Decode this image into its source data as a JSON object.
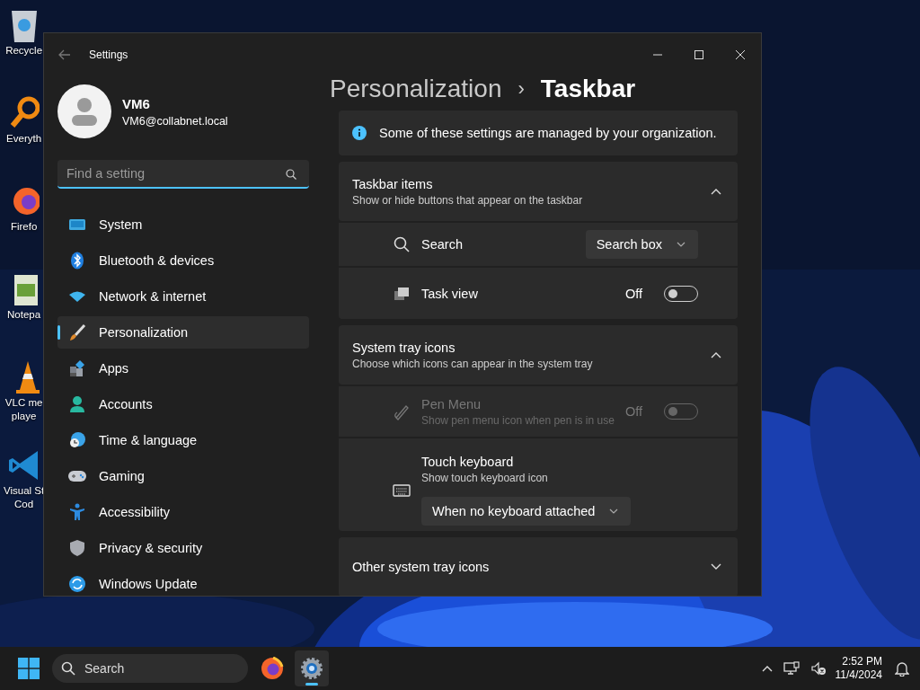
{
  "desktop": {
    "icons": [
      {
        "label": [
          "Recycle"
        ]
      },
      {
        "label": [
          "Everyth"
        ]
      },
      {
        "label": [
          "Firefo"
        ]
      },
      {
        "label": [
          "Notepa"
        ]
      },
      {
        "label": [
          "VLC me",
          "playe"
        ]
      },
      {
        "label": [
          "Visual St",
          "Cod"
        ]
      }
    ]
  },
  "window": {
    "title": "Settings"
  },
  "account": {
    "name": "VM6",
    "email": "VM6@collabnet.local"
  },
  "search": {
    "placeholder": "Find a setting"
  },
  "nav": [
    {
      "label": "System",
      "selected": false
    },
    {
      "label": "Bluetooth & devices",
      "selected": false
    },
    {
      "label": "Network & internet",
      "selected": false
    },
    {
      "label": "Personalization",
      "selected": true
    },
    {
      "label": "Apps",
      "selected": false
    },
    {
      "label": "Accounts",
      "selected": false
    },
    {
      "label": "Time & language",
      "selected": false
    },
    {
      "label": "Gaming",
      "selected": false
    },
    {
      "label": "Accessibility",
      "selected": false
    },
    {
      "label": "Privacy & security",
      "selected": false
    },
    {
      "label": "Windows Update",
      "selected": false
    }
  ],
  "breadcrumb": [
    "Personalization",
    "›",
    "Taskbar"
  ],
  "notice": "Some of these settings are managed by your organization.",
  "sections": [
    {
      "title": "Taskbar items",
      "subtitle": "Show or hide buttons that appear on the taskbar",
      "expanded": true,
      "rows": [
        {
          "kind": "dropdown",
          "label": "Search",
          "value": "Search box",
          "disabled": false
        },
        {
          "kind": "toggle",
          "label": "Task view",
          "state": "Off",
          "on": false,
          "disabled": false
        }
      ]
    },
    {
      "title": "System tray icons",
      "subtitle": "Choose which icons can appear in the system tray",
      "expanded": true,
      "rows": [
        {
          "kind": "toggle",
          "label": "Pen Menu",
          "subtitle": "Show pen menu icon when pen is in use",
          "state": "Off",
          "on": false,
          "disabled": true
        },
        {
          "kind": "dropdown-below",
          "label": "Touch keyboard",
          "subtitle": "Show touch keyboard icon",
          "value": "When no keyboard attached",
          "disabled": false
        }
      ]
    },
    {
      "title": "Other system tray icons",
      "expanded": false
    }
  ],
  "taskbar": {
    "search": "Search",
    "apps": [
      {
        "selected": false
      },
      {
        "selected": true
      }
    ],
    "time": "2:52 PM",
    "date": "11/4/2024"
  }
}
